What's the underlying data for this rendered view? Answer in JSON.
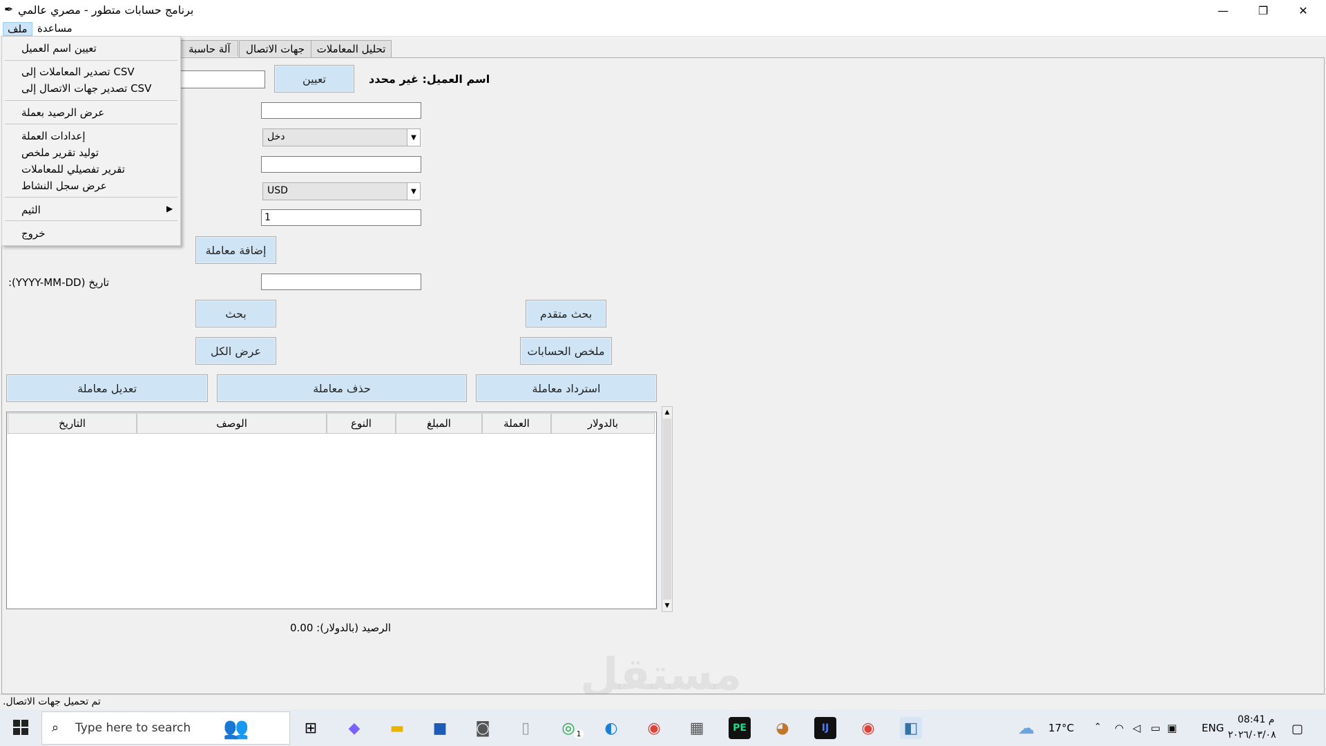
{
  "window": {
    "title": "برنامج حسابات متطور - مصري عالمي",
    "minimize": "—",
    "restore": "❐",
    "close": "✕"
  },
  "menubar": {
    "file": "ملف",
    "help": "مساعدة"
  },
  "tabs": [
    "تحليل المعاملات",
    "جهات الاتصال",
    "آلة حاسبة ع"
  ],
  "form": {
    "set_button": "تعيين",
    "customer_label": "اسم العميل: غير محدد",
    "type_value": "دخل",
    "currency_value": "USD",
    "rate_value": "1",
    "add_button": "إضافة معاملة",
    "date_label": "تاريخ (YYYY-MM-DD):",
    "search_button": "بحث",
    "advanced_search_button": "بحث متقدم",
    "show_all_button": "عرض الكل",
    "summary_button": "ملخص الحسابات",
    "edit_button": "تعديل معاملة",
    "delete_button": "حذف معاملة",
    "restore_button": "استرداد معاملة"
  },
  "table": {
    "columns": [
      "التاريخ",
      "الوصف",
      "النوع",
      "المبلغ",
      "العملة",
      "بالدولار"
    ],
    "rows": []
  },
  "balance": "الرصيد (بالدولار): 0.00",
  "status": "تم تحميل جهات الاتصال.",
  "file_menu": {
    "set_customer": "تعيين اسم العميل",
    "export_transactions": "تصدير المعاملات إلى CSV",
    "export_contacts": "تصدير جهات الاتصال إلى CSV",
    "balance_currency": "عرض الرصيد بعملة",
    "currency_settings": "إعدادات العملة",
    "summary_report": "توليد تقرير ملخص",
    "detailed_report": "تقرير تفصيلي للمعاملات",
    "activity_log": "عرض سجل النشاط",
    "theme": "الثيم",
    "exit": "خروج"
  },
  "taskbar": {
    "search_placeholder": "Type here to search",
    "weather": "17°C",
    "language": "ENG",
    "time": "08:41 م",
    "date": "٢٠٢٦/٠٣/٠٨",
    "whatsapp_badge": "1"
  },
  "watermark": "مستقل"
}
